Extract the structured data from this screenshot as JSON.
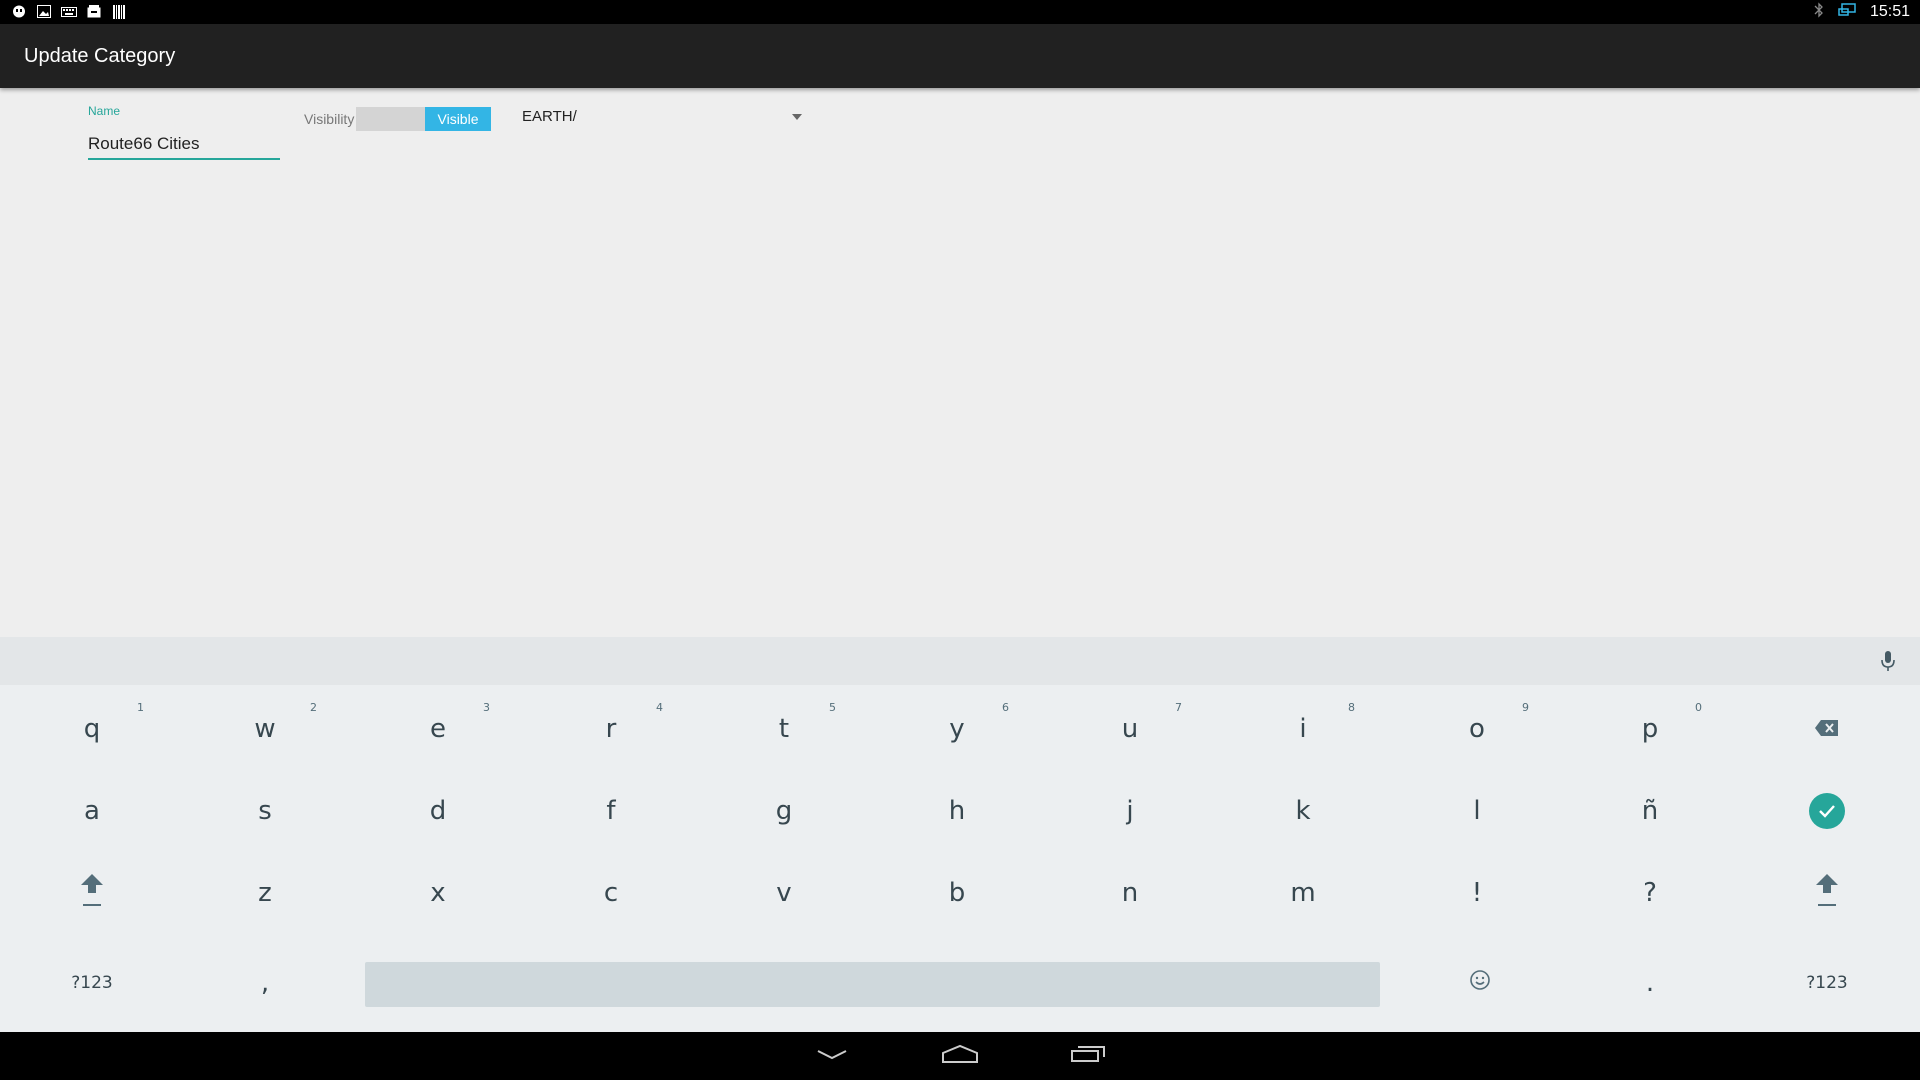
{
  "status_bar": {
    "time": "15:51",
    "left_icons": [
      "hangouts-icon",
      "image-icon",
      "keyboard-icon",
      "inbox-icon",
      "barcode-icon"
    ],
    "right_icons": [
      "bluetooth-icon",
      "screen-cast-icon"
    ]
  },
  "action_bar": {
    "title": "Update Category"
  },
  "form": {
    "name_label": "Name",
    "name_value": "Route66 Cities",
    "visibility_label": "Visibility",
    "visibility_state": "Visible",
    "parent_value": "EARTH/"
  },
  "keyboard": {
    "row1": [
      {
        "key": "q",
        "hint": "1"
      },
      {
        "key": "w",
        "hint": "2"
      },
      {
        "key": "e",
        "hint": "3"
      },
      {
        "key": "r",
        "hint": "4"
      },
      {
        "key": "t",
        "hint": "5"
      },
      {
        "key": "y",
        "hint": "6"
      },
      {
        "key": "u",
        "hint": "7"
      },
      {
        "key": "i",
        "hint": "8"
      },
      {
        "key": "o",
        "hint": "9"
      },
      {
        "key": "p",
        "hint": "0"
      }
    ],
    "row2": [
      "a",
      "s",
      "d",
      "f",
      "g",
      "h",
      "j",
      "k",
      "l",
      "ñ"
    ],
    "row3": [
      "z",
      "x",
      "c",
      "v",
      "b",
      "n",
      "m",
      "!",
      "?"
    ],
    "row4": {
      "symbols_left": "?123",
      "comma": ",",
      "period": ".",
      "symbols_right": "?123"
    },
    "accent_color": "#26a69a"
  },
  "colors": {
    "accent": "#26a69a",
    "toggle_on": "#33b5e5",
    "action_bar": "#212121"
  }
}
